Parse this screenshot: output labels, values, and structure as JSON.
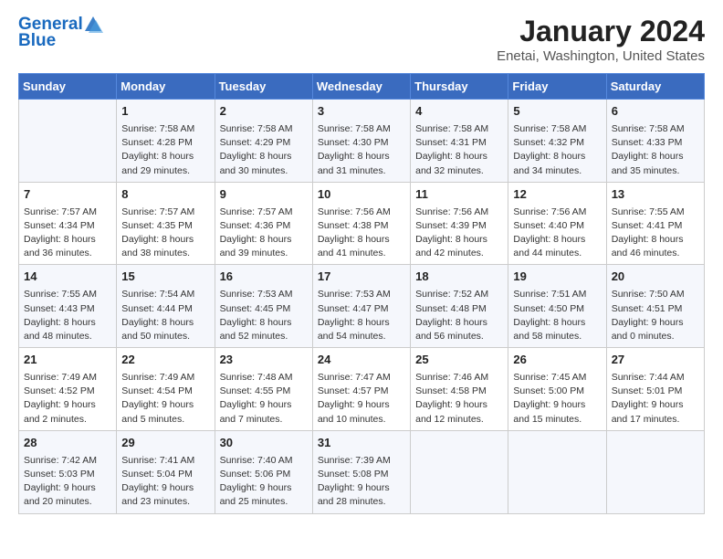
{
  "header": {
    "logo_line1": "General",
    "logo_line2": "Blue",
    "title": "January 2024",
    "subtitle": "Enetai, Washington, United States"
  },
  "days": [
    "Sunday",
    "Monday",
    "Tuesday",
    "Wednesday",
    "Thursday",
    "Friday",
    "Saturday"
  ],
  "weeks": [
    [
      {
        "date": "",
        "info": ""
      },
      {
        "date": "1",
        "info": "Sunrise: 7:58 AM\nSunset: 4:28 PM\nDaylight: 8 hours\nand 29 minutes."
      },
      {
        "date": "2",
        "info": "Sunrise: 7:58 AM\nSunset: 4:29 PM\nDaylight: 8 hours\nand 30 minutes."
      },
      {
        "date": "3",
        "info": "Sunrise: 7:58 AM\nSunset: 4:30 PM\nDaylight: 8 hours\nand 31 minutes."
      },
      {
        "date": "4",
        "info": "Sunrise: 7:58 AM\nSunset: 4:31 PM\nDaylight: 8 hours\nand 32 minutes."
      },
      {
        "date": "5",
        "info": "Sunrise: 7:58 AM\nSunset: 4:32 PM\nDaylight: 8 hours\nand 34 minutes."
      },
      {
        "date": "6",
        "info": "Sunrise: 7:58 AM\nSunset: 4:33 PM\nDaylight: 8 hours\nand 35 minutes."
      }
    ],
    [
      {
        "date": "7",
        "info": "Sunrise: 7:57 AM\nSunset: 4:34 PM\nDaylight: 8 hours\nand 36 minutes."
      },
      {
        "date": "8",
        "info": "Sunrise: 7:57 AM\nSunset: 4:35 PM\nDaylight: 8 hours\nand 38 minutes."
      },
      {
        "date": "9",
        "info": "Sunrise: 7:57 AM\nSunset: 4:36 PM\nDaylight: 8 hours\nand 39 minutes."
      },
      {
        "date": "10",
        "info": "Sunrise: 7:56 AM\nSunset: 4:38 PM\nDaylight: 8 hours\nand 41 minutes."
      },
      {
        "date": "11",
        "info": "Sunrise: 7:56 AM\nSunset: 4:39 PM\nDaylight: 8 hours\nand 42 minutes."
      },
      {
        "date": "12",
        "info": "Sunrise: 7:56 AM\nSunset: 4:40 PM\nDaylight: 8 hours\nand 44 minutes."
      },
      {
        "date": "13",
        "info": "Sunrise: 7:55 AM\nSunset: 4:41 PM\nDaylight: 8 hours\nand 46 minutes."
      }
    ],
    [
      {
        "date": "14",
        "info": "Sunrise: 7:55 AM\nSunset: 4:43 PM\nDaylight: 8 hours\nand 48 minutes."
      },
      {
        "date": "15",
        "info": "Sunrise: 7:54 AM\nSunset: 4:44 PM\nDaylight: 8 hours\nand 50 minutes."
      },
      {
        "date": "16",
        "info": "Sunrise: 7:53 AM\nSunset: 4:45 PM\nDaylight: 8 hours\nand 52 minutes."
      },
      {
        "date": "17",
        "info": "Sunrise: 7:53 AM\nSunset: 4:47 PM\nDaylight: 8 hours\nand 54 minutes."
      },
      {
        "date": "18",
        "info": "Sunrise: 7:52 AM\nSunset: 4:48 PM\nDaylight: 8 hours\nand 56 minutes."
      },
      {
        "date": "19",
        "info": "Sunrise: 7:51 AM\nSunset: 4:50 PM\nDaylight: 8 hours\nand 58 minutes."
      },
      {
        "date": "20",
        "info": "Sunrise: 7:50 AM\nSunset: 4:51 PM\nDaylight: 9 hours\nand 0 minutes."
      }
    ],
    [
      {
        "date": "21",
        "info": "Sunrise: 7:49 AM\nSunset: 4:52 PM\nDaylight: 9 hours\nand 2 minutes."
      },
      {
        "date": "22",
        "info": "Sunrise: 7:49 AM\nSunset: 4:54 PM\nDaylight: 9 hours\nand 5 minutes."
      },
      {
        "date": "23",
        "info": "Sunrise: 7:48 AM\nSunset: 4:55 PM\nDaylight: 9 hours\nand 7 minutes."
      },
      {
        "date": "24",
        "info": "Sunrise: 7:47 AM\nSunset: 4:57 PM\nDaylight: 9 hours\nand 10 minutes."
      },
      {
        "date": "25",
        "info": "Sunrise: 7:46 AM\nSunset: 4:58 PM\nDaylight: 9 hours\nand 12 minutes."
      },
      {
        "date": "26",
        "info": "Sunrise: 7:45 AM\nSunset: 5:00 PM\nDaylight: 9 hours\nand 15 minutes."
      },
      {
        "date": "27",
        "info": "Sunrise: 7:44 AM\nSunset: 5:01 PM\nDaylight: 9 hours\nand 17 minutes."
      }
    ],
    [
      {
        "date": "28",
        "info": "Sunrise: 7:42 AM\nSunset: 5:03 PM\nDaylight: 9 hours\nand 20 minutes."
      },
      {
        "date": "29",
        "info": "Sunrise: 7:41 AM\nSunset: 5:04 PM\nDaylight: 9 hours\nand 23 minutes."
      },
      {
        "date": "30",
        "info": "Sunrise: 7:40 AM\nSunset: 5:06 PM\nDaylight: 9 hours\nand 25 minutes."
      },
      {
        "date": "31",
        "info": "Sunrise: 7:39 AM\nSunset: 5:08 PM\nDaylight: 9 hours\nand 28 minutes."
      },
      {
        "date": "",
        "info": ""
      },
      {
        "date": "",
        "info": ""
      },
      {
        "date": "",
        "info": ""
      }
    ]
  ]
}
